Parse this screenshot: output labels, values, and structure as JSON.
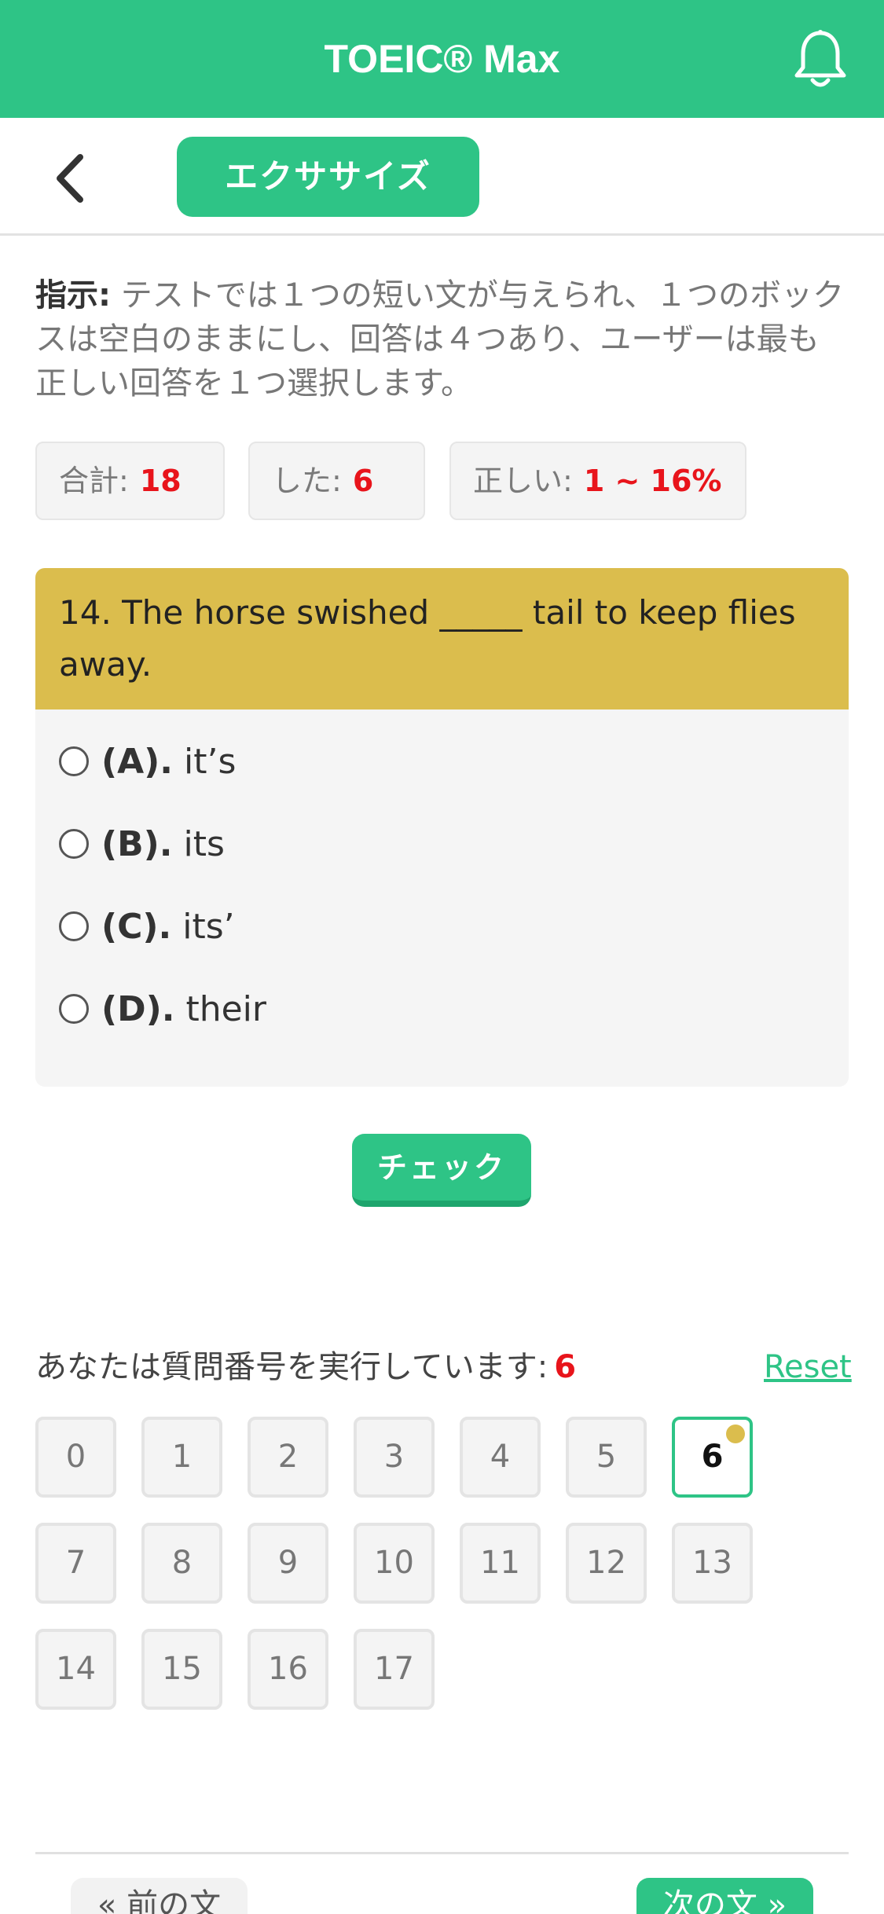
{
  "header": {
    "title": "TOEIC® Max",
    "bell_icon": "bell-icon"
  },
  "subbar": {
    "back_icon": "chevron-left-icon",
    "tab_label": "エクササイズ"
  },
  "instructions": {
    "label": "指示:",
    "text": " テストでは１つの短い文が与えられ、１つのボックスは空白のままにし、回答は４つあり、ユーザーは最も正しい回答を１つ選択します。"
  },
  "stats": {
    "total_label": "合計:",
    "total_value": "18",
    "done_label": "した:",
    "done_value": "6",
    "correct_label": "正しい:",
    "correct_value": "1 ~ 16%"
  },
  "question": {
    "text": "14. The horse swished _____ tail to keep flies away.",
    "options": [
      {
        "letter": "(A).",
        "text": "it’s"
      },
      {
        "letter": "(B).",
        "text": "its"
      },
      {
        "letter": "(C).",
        "text": "its’"
      },
      {
        "letter": "(D).",
        "text": "their"
      }
    ]
  },
  "check_label": "チェック",
  "progress": {
    "label": "あなたは質問番号を実行しています:",
    "current": "6",
    "reset_label": "Reset",
    "numbers": [
      "0",
      "1",
      "2",
      "3",
      "4",
      "5",
      "6",
      "7",
      "8",
      "9",
      "10",
      "11",
      "12",
      "13",
      "14",
      "15",
      "16",
      "17"
    ]
  },
  "footer": {
    "prev_label": "« 前の文",
    "next_label": "次の文 »"
  },
  "colors": {
    "primary": "#2ec486",
    "question_bg": "#dbbd4d",
    "highlight_red": "#e8141b"
  }
}
